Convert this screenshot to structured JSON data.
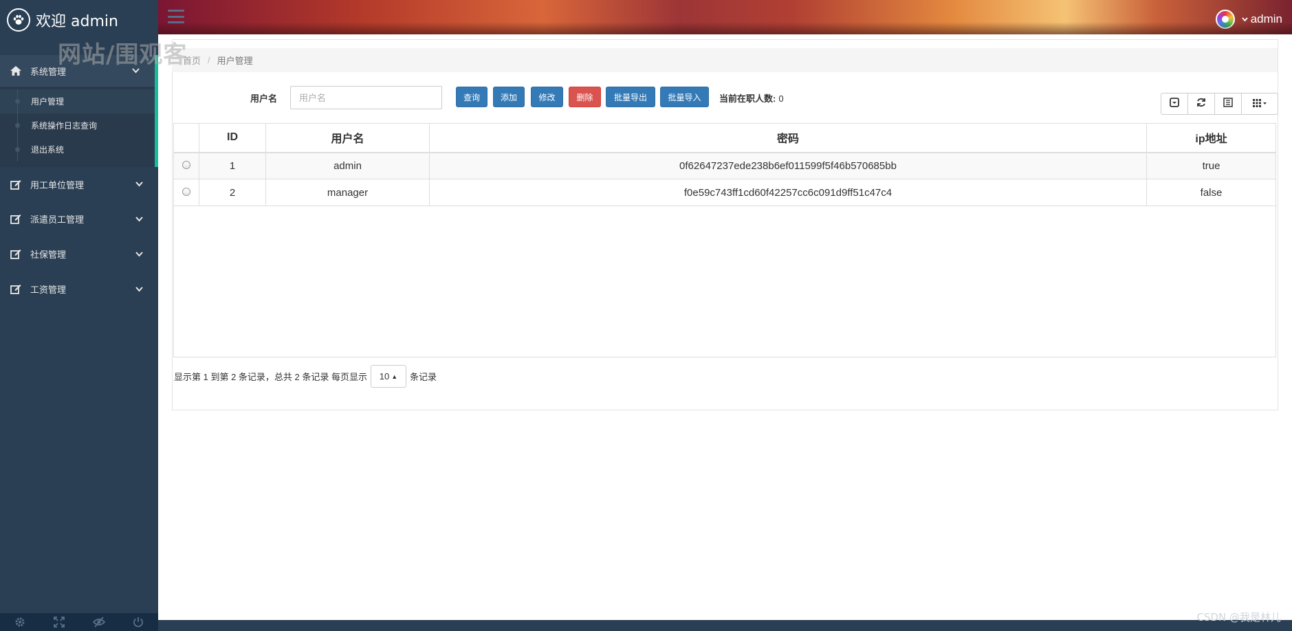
{
  "brand": {
    "title": "欢迎 admin"
  },
  "watermark": "网站/围观客",
  "sidebar": {
    "groups": [
      {
        "label": "系统管理",
        "icon": "home-icon",
        "expanded": true,
        "items": [
          {
            "label": "用户管理",
            "active": true
          },
          {
            "label": "系统操作日志查询"
          },
          {
            "label": "退出系统"
          }
        ]
      },
      {
        "label": "用工单位管理",
        "icon": "edit-icon"
      },
      {
        "label": "派遣员工管理",
        "icon": "edit-icon"
      },
      {
        "label": "社保管理",
        "icon": "edit-icon"
      },
      {
        "label": "工资管理",
        "icon": "edit-icon"
      }
    ],
    "footer_icons": [
      "gear-icon",
      "fullscreen-icon",
      "eye-slash-icon",
      "power-icon"
    ]
  },
  "topnav": {
    "user_name": "admin"
  },
  "breadcrumb": {
    "home": "首页",
    "current": "用户管理"
  },
  "search": {
    "label": "用户名",
    "placeholder": "用户名",
    "value": "",
    "buttons": {
      "query": "查询",
      "add": "添加",
      "edit": "修改",
      "delete": "删除",
      "export": "批量导出",
      "import": "批量导入"
    },
    "count_label": "当前在职人数:",
    "count_value": "0"
  },
  "table": {
    "columns": [
      "ID",
      "用户名",
      "密码",
      "ip地址"
    ],
    "rows": [
      {
        "id": "1",
        "username": "admin",
        "password": "0f62647237ede238b6ef011599f5f46b570685bb",
        "ip": "true"
      },
      {
        "id": "2",
        "username": "manager",
        "password": "f0e59c743ff1cd60f42257cc6c091d9ff51c47c4",
        "ip": "false"
      }
    ]
  },
  "pagination": {
    "prefix": "显示第 1 到第 2 条记录，总共 2 条记录 每页显示",
    "page_size": "10",
    "suffix": "条记录"
  },
  "footer_watermark": "CSDN @我是林儿",
  "colors": {
    "sidebar_bg": "#2a3f54",
    "accent": "#1abb9c",
    "primary_button": "#337ab7",
    "danger_button": "#d9534f"
  }
}
